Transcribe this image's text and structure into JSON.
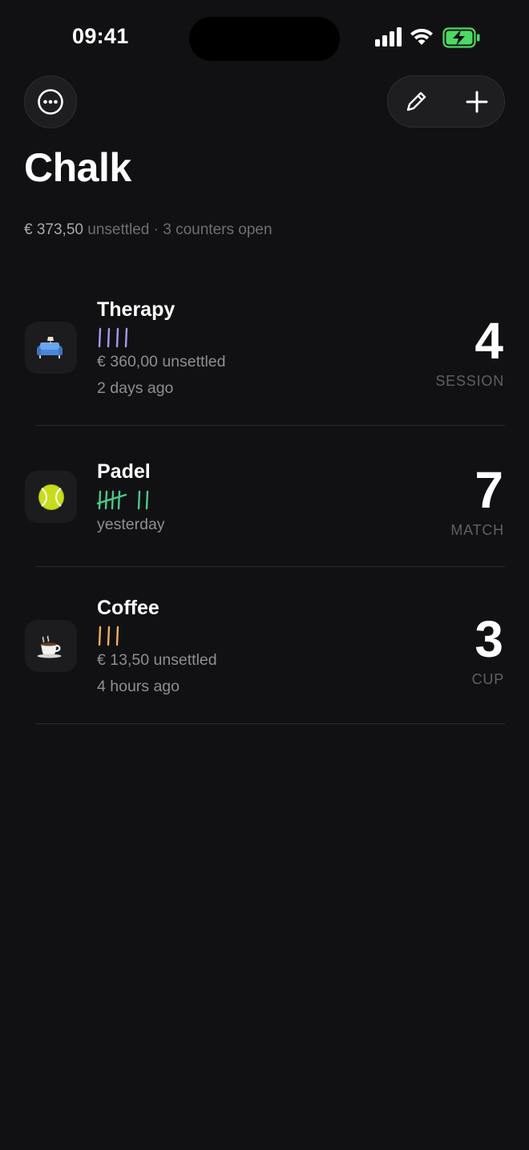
{
  "status_bar": {
    "time": "09:41",
    "battery_color": "#4cd964"
  },
  "header": {
    "menu_icon": "ellipsis-circle-icon",
    "edit_icon": "pencil-icon",
    "add_icon": "plus-icon",
    "title": "Chalk"
  },
  "summary": {
    "amount": "€ 373,50",
    "unsettled_label": "unsettled",
    "separator": "·",
    "open_label": "3 counters open"
  },
  "counters": [
    {
      "name": "Therapy",
      "icon": "couch-and-lamp-icon",
      "tally_color": "#a89af0",
      "tally_count": 4,
      "unsettled": "€ 360,00 unsettled",
      "last": "2 days ago",
      "count": "4",
      "unit": "SESSION"
    },
    {
      "name": "Padel",
      "icon": "tennis-ball-icon",
      "tally_color": "#4bc98a",
      "tally_count": 7,
      "unsettled": "",
      "last": "yesterday",
      "count": "7",
      "unit": "MATCH"
    },
    {
      "name": "Coffee",
      "icon": "coffee-cup-icon",
      "tally_color": "#f0b060",
      "tally_count": 3,
      "unsettled": "€ 13,50 unsettled",
      "last": "4 hours ago",
      "count": "3",
      "unit": "CUP"
    }
  ]
}
